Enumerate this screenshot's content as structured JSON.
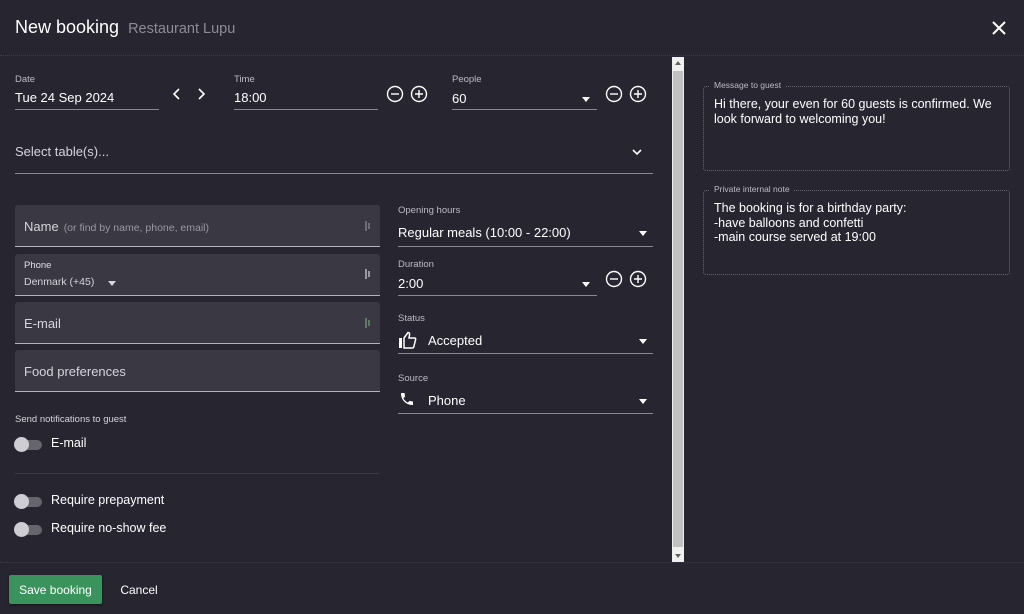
{
  "header": {
    "title": "New booking",
    "subtitle": "Restaurant Lupu",
    "close_icon": "close-icon"
  },
  "date": {
    "label": "Date",
    "value": "Tue 24 Sep 2024"
  },
  "time": {
    "label": "Time",
    "value": "18:00"
  },
  "people": {
    "label": "People",
    "value": "60"
  },
  "tables": {
    "placeholder": "Select table(s)..."
  },
  "guest": {
    "name_label": "Name",
    "name_hint": "(or find by name, phone, email)",
    "phone_label": "Phone",
    "phone_country": "Denmark (+45)",
    "email_label": "E-mail",
    "food_label": "Food preferences"
  },
  "notifications": {
    "heading": "Send notifications to guest",
    "email_toggle": {
      "label": "E-mail",
      "on": false
    }
  },
  "payments": {
    "prepayment": {
      "label": "Require prepayment",
      "on": false
    },
    "no_show_fee": {
      "label": "Require no-show fee",
      "on": false
    }
  },
  "opening_hours": {
    "label": "Opening hours",
    "value": "Regular meals (10:00 - 22:00)"
  },
  "duration": {
    "label": "Duration",
    "value": "2:00"
  },
  "status": {
    "label": "Status",
    "value": "Accepted",
    "icon": "thumbs-up-icon"
  },
  "source": {
    "label": "Source",
    "value": "Phone",
    "icon": "phone-icon"
  },
  "message_to_guest": {
    "label": "Message to guest",
    "text": "Hi there, your even for 60 guests is confirmed. We look forward to welcoming you!"
  },
  "internal_note": {
    "label": "Private internal note",
    "text": "The booking is for a birthday party:\n-have balloons and confetti\n-main course served at 19:00"
  },
  "footer": {
    "save_label": "Save booking",
    "cancel_label": "Cancel"
  },
  "colors": {
    "background": "#27252f",
    "field_background": "#3a3842",
    "primary_button": "#3a935c"
  }
}
